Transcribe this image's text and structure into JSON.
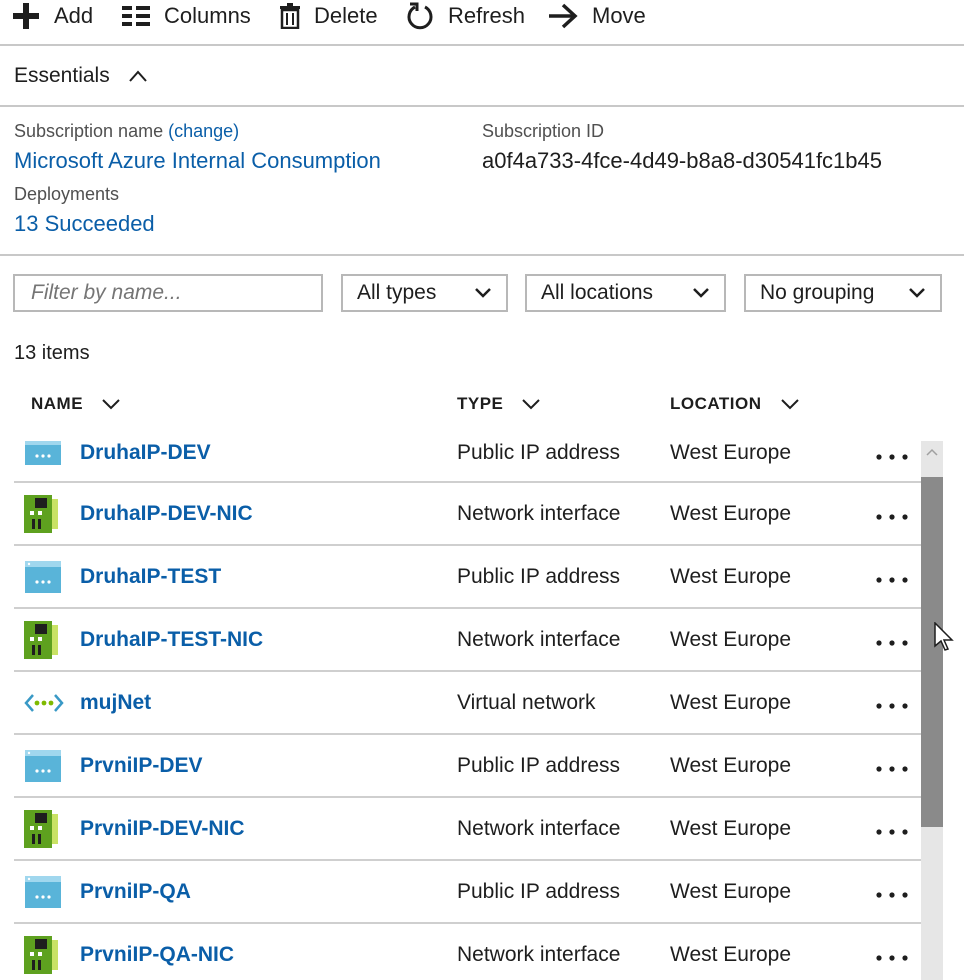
{
  "toolbar": {
    "add": "Add",
    "columns": "Columns",
    "delete": "Delete",
    "refresh": "Refresh",
    "move": "Move"
  },
  "essentials": {
    "title": "Essentials",
    "subscription_name_label": "Subscription name",
    "change_link": "(change)",
    "subscription_name": "Microsoft Azure Internal Consumption",
    "subscription_id_label": "Subscription ID",
    "subscription_id": "a0f4a733-4fce-4d49-b8a8-d30541fc1b45",
    "deployments_label": "Deployments",
    "deployments_value": "13 Succeeded"
  },
  "filters": {
    "name_placeholder": "Filter by name...",
    "types": "All types",
    "locations": "All locations",
    "grouping": "No grouping"
  },
  "item_count": "13 items",
  "columns": {
    "name": "NAME",
    "type": "TYPE",
    "location": "LOCATION"
  },
  "rows": [
    {
      "name": "DruhaIP-DEV",
      "type": "Public IP address",
      "location": "West Europe",
      "icon": "public-ip-icon"
    },
    {
      "name": "DruhaIP-DEV-NIC",
      "type": "Network interface",
      "location": "West Europe",
      "icon": "network-interface-icon"
    },
    {
      "name": "DruhaIP-TEST",
      "type": "Public IP address",
      "location": "West Europe",
      "icon": "public-ip-icon"
    },
    {
      "name": "DruhaIP-TEST-NIC",
      "type": "Network interface",
      "location": "West Europe",
      "icon": "network-interface-icon"
    },
    {
      "name": "mujNet",
      "type": "Virtual network",
      "location": "West Europe",
      "icon": "virtual-network-icon"
    },
    {
      "name": "PrvniIP-DEV",
      "type": "Public IP address",
      "location": "West Europe",
      "icon": "public-ip-icon"
    },
    {
      "name": "PrvniIP-DEV-NIC",
      "type": "Network interface",
      "location": "West Europe",
      "icon": "network-interface-icon"
    },
    {
      "name": "PrvniIP-QA",
      "type": "Public IP address",
      "location": "West Europe",
      "icon": "public-ip-icon"
    },
    {
      "name": "PrvniIP-QA-NIC",
      "type": "Network interface",
      "location": "West Europe",
      "icon": "network-interface-icon"
    }
  ],
  "colors": {
    "link": "#0a5ea8",
    "nic_green": "#5ea11f",
    "ip_blue": "#59b4d9"
  }
}
